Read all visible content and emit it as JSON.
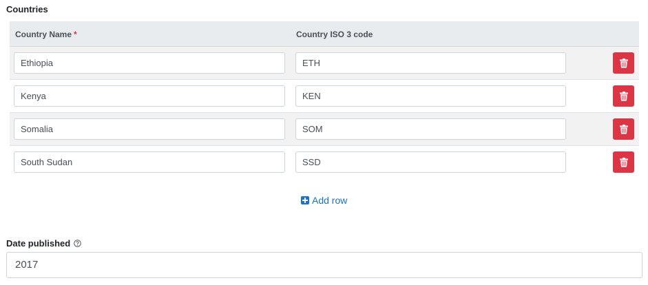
{
  "countries": {
    "section_label": "Countries",
    "columns": {
      "name": "Country Name",
      "name_required_marker": "*",
      "iso": "Country ISO 3 code"
    },
    "rows": [
      {
        "name": "Ethiopia",
        "iso": "ETH"
      },
      {
        "name": "Kenya",
        "iso": "KEN"
      },
      {
        "name": "Somalia",
        "iso": "SOM"
      },
      {
        "name": "South Sudan",
        "iso": "SSD"
      }
    ],
    "add_row_label": "Add row",
    "icons": {
      "delete": "trash-icon",
      "add": "plus-square-icon"
    }
  },
  "date_published": {
    "label": "Date published",
    "help_icon": "question-circle-icon",
    "value": "2017"
  },
  "colors": {
    "danger": "#dc3545",
    "link": "#1a73c8",
    "header_bg": "#e9ecef",
    "stripe_bg": "#f2f2f2"
  }
}
